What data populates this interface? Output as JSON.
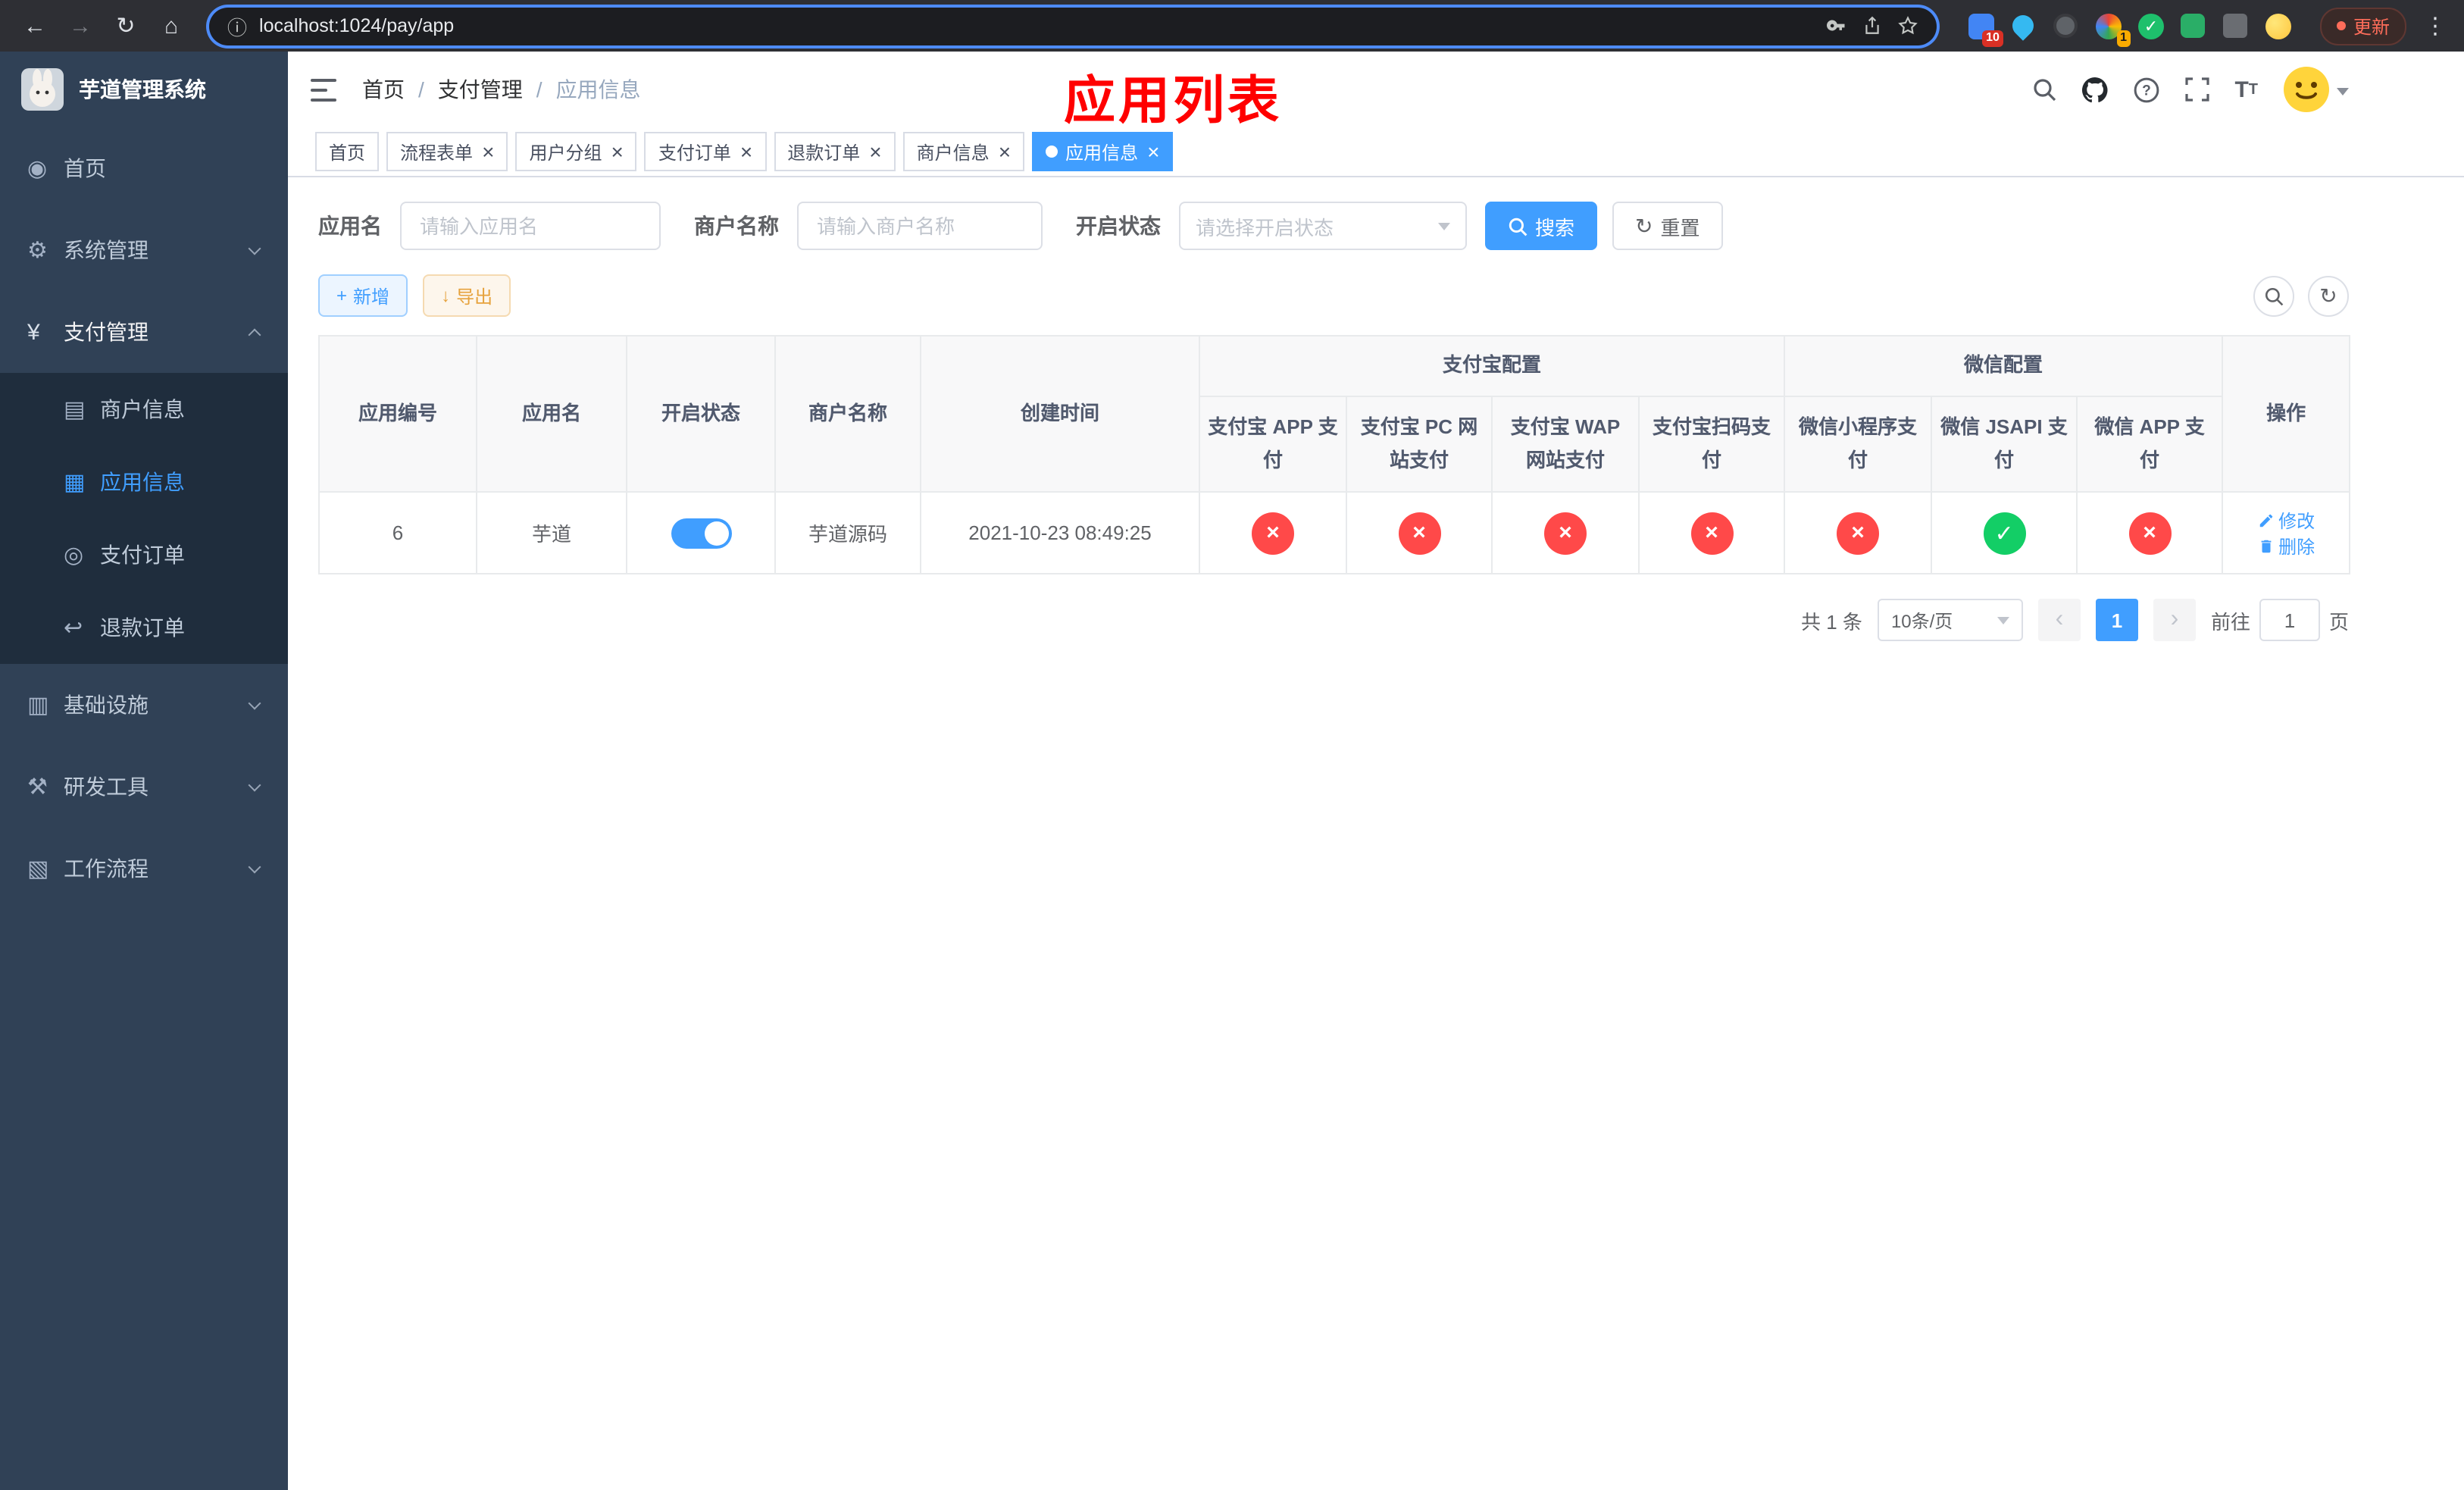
{
  "colors": {
    "primary": "#409eff",
    "success": "#13ce66",
    "danger": "#ff4949",
    "warning": "#e6a23c"
  },
  "browser": {
    "url": "localhost:1024/pay/app",
    "update_label": "更新",
    "extension_badges": {
      "first": "10",
      "second": "1"
    }
  },
  "sidebar": {
    "logo_title": "芋道管理系统",
    "items": [
      {
        "label": "首页",
        "icon": "dashboard-icon",
        "type": "item"
      },
      {
        "label": "系统管理",
        "icon": "gear-icon",
        "type": "group",
        "expanded": false
      },
      {
        "label": "支付管理",
        "icon": "yen-icon",
        "type": "group",
        "expanded": true,
        "children": [
          {
            "label": "商户信息",
            "icon": "card-icon",
            "active": false
          },
          {
            "label": "应用信息",
            "icon": "grid-icon",
            "active": true
          },
          {
            "label": "支付订单",
            "icon": "order-icon",
            "active": false
          },
          {
            "label": "退款订单",
            "icon": "refund-icon",
            "active": false
          }
        ]
      },
      {
        "label": "基础设施",
        "icon": "infra-icon",
        "type": "group",
        "expanded": false
      },
      {
        "label": "研发工具",
        "icon": "tools-icon",
        "type": "group",
        "expanded": false
      },
      {
        "label": "工作流程",
        "icon": "workflow-icon",
        "type": "group",
        "expanded": false
      }
    ]
  },
  "header": {
    "breadcrumb": [
      "首页",
      "支付管理",
      "应用信息"
    ],
    "annotation": "应用列表"
  },
  "tabs": [
    {
      "label": "首页",
      "closable": false,
      "active": false
    },
    {
      "label": "流程表单",
      "closable": true,
      "active": false
    },
    {
      "label": "用户分组",
      "closable": true,
      "active": false
    },
    {
      "label": "支付订单",
      "closable": true,
      "active": false
    },
    {
      "label": "退款订单",
      "closable": true,
      "active": false
    },
    {
      "label": "商户信息",
      "closable": true,
      "active": false
    },
    {
      "label": "应用信息",
      "closable": true,
      "active": true
    }
  ],
  "filters": {
    "app_name_label": "应用名",
    "app_name_placeholder": "请输入应用名",
    "merchant_label": "商户名称",
    "merchant_placeholder": "请输入商户名称",
    "status_label": "开启状态",
    "status_placeholder": "请选择开启状态",
    "search_label": "搜索",
    "reset_label": "重置"
  },
  "toolbar": {
    "add_label": "新增",
    "export_label": "导出"
  },
  "table": {
    "simple_headers": [
      "应用编号",
      "应用名",
      "开启状态",
      "商户名称",
      "创建时间"
    ],
    "group_headers": [
      {
        "label": "支付宝配置",
        "cols": [
          "支付宝 APP 支付",
          "支付宝 PC 网站支付",
          "支付宝 WAP 网站支付",
          "支付宝扫码支付"
        ]
      },
      {
        "label": "微信配置",
        "cols": [
          "微信小程序支付",
          "微信 JSAPI 支付",
          "微信 APP 支付"
        ]
      }
    ],
    "ops_header": "操作",
    "rows": [
      {
        "id": "6",
        "name": "芋道",
        "enabled": true,
        "merchant": "芋道源码",
        "created": "2021-10-23 08:49:25",
        "configs": [
          false,
          false,
          false,
          false,
          false,
          true,
          false
        ],
        "edit_label": "修改",
        "delete_label": "删除"
      }
    ]
  },
  "pagination": {
    "total_text": "共 1 条",
    "page_size_label": "10条/页",
    "current_page": "1",
    "goto_label": "前往",
    "goto_value": "1",
    "goto_unit": "页"
  }
}
